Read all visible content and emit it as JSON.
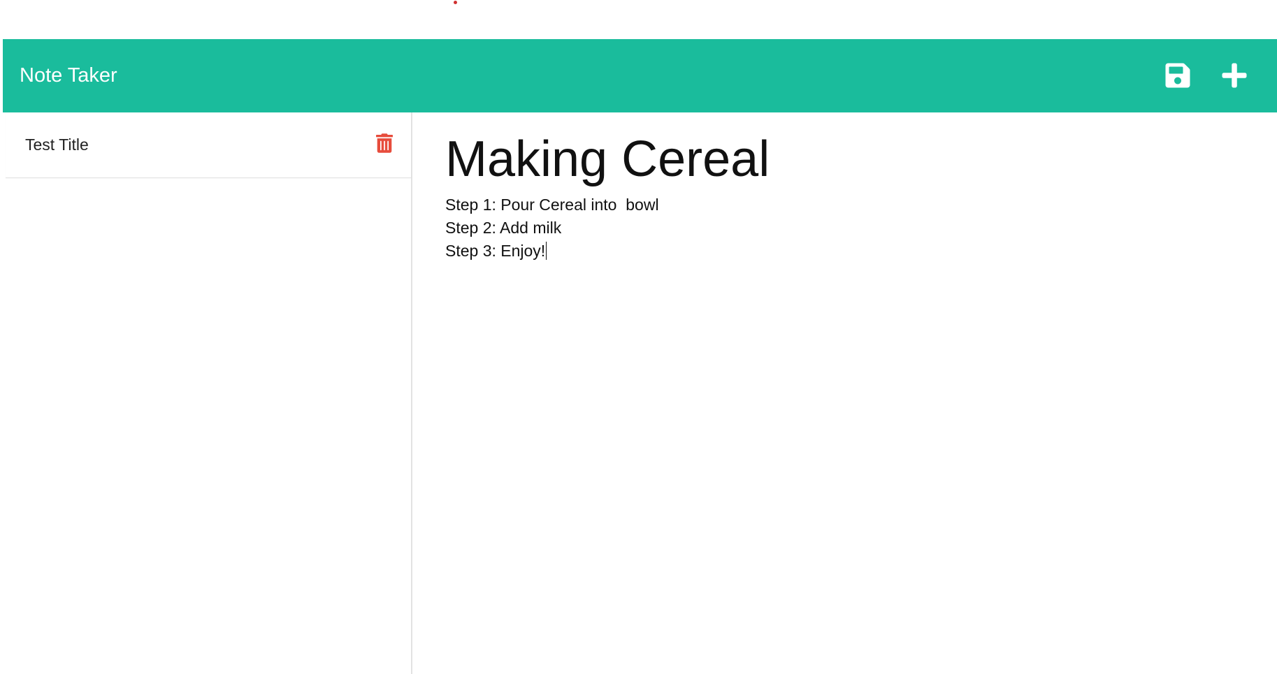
{
  "app": {
    "title": "Note Taker",
    "accent_color": "#1abc9c",
    "delete_color": "#e74c3c"
  },
  "navbar": {
    "icons": [
      "save-icon",
      "plus-icon"
    ]
  },
  "sidebar": {
    "notes": [
      {
        "title": "Test Title",
        "icon": "trash-icon"
      }
    ]
  },
  "editor": {
    "title": "Making Cereal",
    "lines": [
      "Step 1: Pour Cereal into  bowl",
      "Step 2: Add milk",
      "Step 3: Enjoy!"
    ]
  }
}
